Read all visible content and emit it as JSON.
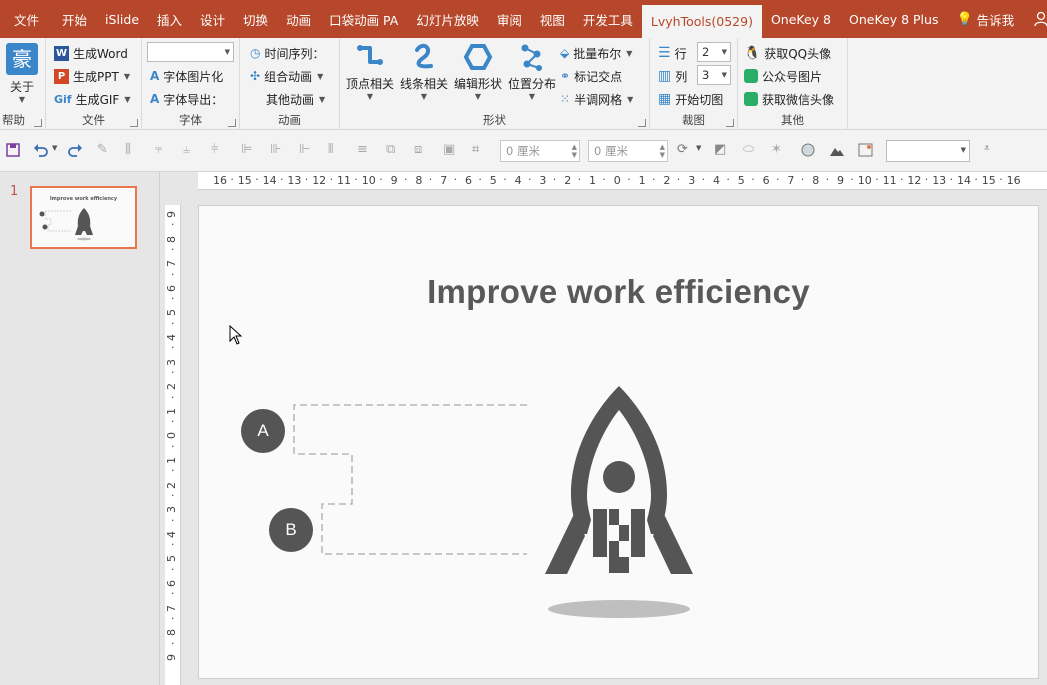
{
  "tabs": [
    "文件",
    "开始",
    "iSlide",
    "插入",
    "设计",
    "切换",
    "动画",
    "口袋动画 PA",
    "幻灯片放映",
    "审阅",
    "视图",
    "开发工具",
    "LvyhTools(0529)",
    "OneKey 8",
    "OneKey 8 Plus",
    "告诉我"
  ],
  "active_tab": "LvyhTools(0529)",
  "ribbon": {
    "help": {
      "button": "关于",
      "icon_char": "豪",
      "label": "帮助"
    },
    "file": {
      "items": [
        "生成Word",
        "生成PPT",
        "生成GIF"
      ],
      "gif_icon": "Gif",
      "label": "文件"
    },
    "font": {
      "items": [
        "字体图片化",
        "字体导出："
      ],
      "label": "字体"
    },
    "animation": {
      "items": [
        "时间序列：",
        "组合动画",
        "其他动画"
      ],
      "label": "动画"
    },
    "shape": {
      "big_buttons": [
        "顶点相关",
        "线条相关",
        "编辑形状",
        "位置分布"
      ],
      "items": [
        "批量布尔",
        "标记交点",
        "半调网格"
      ],
      "label": "形状"
    },
    "crop": {
      "row_label": "行",
      "col_label": "列",
      "row_value": "2",
      "col_value": "3",
      "button": "开始切图",
      "label": "裁图"
    },
    "other": {
      "items": [
        "获取QQ头像",
        "公众号图片",
        "获取微信头像"
      ],
      "label": "其他"
    }
  },
  "toolbar": {
    "spin1": "0 厘米",
    "spin2": "0 厘米"
  },
  "thumbnail": {
    "number": "1",
    "mini_title": "Improve work efficiency"
  },
  "slide": {
    "title": "Improve work efficiency",
    "circle_a": "A",
    "circle_b": "B"
  },
  "ruler_h": [
    "16",
    "15",
    "14",
    "13",
    "12",
    "11",
    "10",
    "9",
    "8",
    "7",
    "6",
    "5",
    "4",
    "3",
    "2",
    "1",
    "0",
    "1",
    "2",
    "3",
    "4",
    "5",
    "6",
    "7",
    "8",
    "9",
    "10",
    "11",
    "12",
    "13",
    "14",
    "15",
    "16"
  ],
  "ruler_v": [
    "9",
    "8",
    "7",
    "6",
    "5",
    "4",
    "3",
    "2",
    "1",
    "0",
    "1",
    "2",
    "3",
    "4",
    "5",
    "6",
    "7",
    "8",
    "9"
  ],
  "colors": {
    "accent": "#b7472a",
    "shape": "#555555",
    "shadow": "#bfbfbf",
    "thumb_border": "#e9774a"
  }
}
